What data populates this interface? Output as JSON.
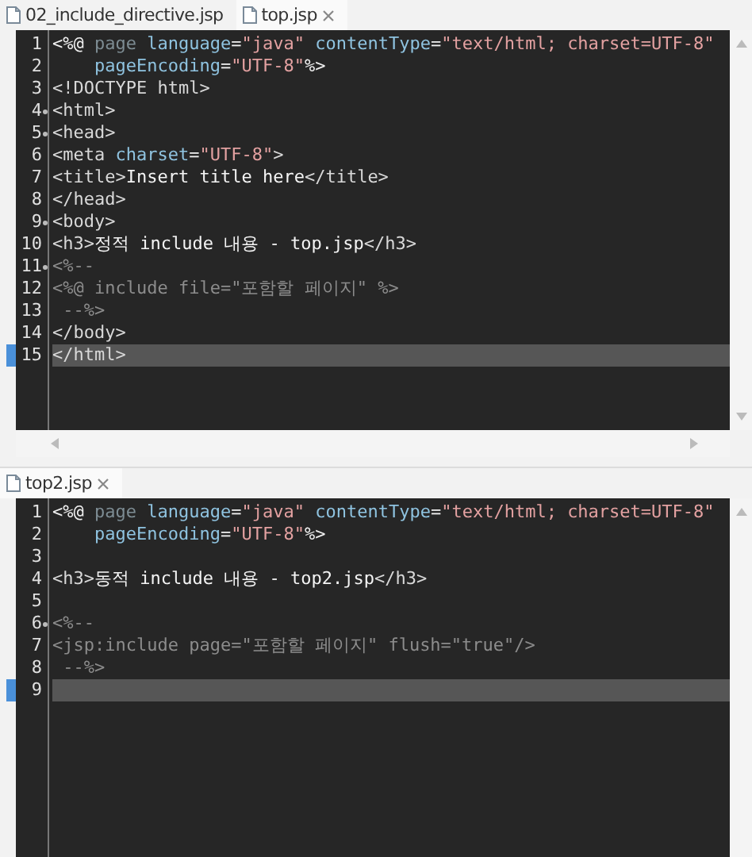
{
  "editors": [
    {
      "tabs": [
        {
          "label": "02_include_directive.jsp",
          "selected": false
        },
        {
          "label": "top.jsp",
          "selected": true
        }
      ],
      "horizontal_scrollbar": true,
      "lines": [
        {
          "number": "1",
          "fold": false,
          "current": false,
          "tokens": [
            {
              "kind": "punct",
              "text": "<%@"
            },
            {
              "kind": "directive",
              "text": " page"
            },
            {
              "kind": "attr",
              "text": " language"
            },
            {
              "kind": "punct",
              "text": "="
            },
            {
              "kind": "string",
              "text": "\"java\""
            },
            {
              "kind": "attr",
              "text": " contentType"
            },
            {
              "kind": "punct",
              "text": "="
            },
            {
              "kind": "string",
              "text": "\"text/html; charset=UTF-8\""
            }
          ]
        },
        {
          "number": "2",
          "fold": false,
          "current": false,
          "tokens": [
            {
              "kind": "attr",
              "text": "    pageEncoding"
            },
            {
              "kind": "punct",
              "text": "="
            },
            {
              "kind": "string",
              "text": "\"UTF-8\""
            },
            {
              "kind": "punct",
              "text": "%>"
            }
          ]
        },
        {
          "number": "3",
          "fold": false,
          "current": false,
          "tokens": [
            {
              "kind": "tag",
              "text": "<!DOCTYPE html>"
            }
          ]
        },
        {
          "number": "4",
          "fold": true,
          "current": false,
          "tokens": [
            {
              "kind": "tag",
              "text": "<html>"
            }
          ]
        },
        {
          "number": "5",
          "fold": true,
          "current": false,
          "tokens": [
            {
              "kind": "tag",
              "text": "<head>"
            }
          ]
        },
        {
          "number": "6",
          "fold": false,
          "current": false,
          "tokens": [
            {
              "kind": "tag",
              "text": "<meta"
            },
            {
              "kind": "attr",
              "text": " charset"
            },
            {
              "kind": "punct",
              "text": "="
            },
            {
              "kind": "string",
              "text": "\"UTF-8\""
            },
            {
              "kind": "tag",
              "text": ">"
            }
          ]
        },
        {
          "number": "7",
          "fold": false,
          "current": false,
          "tokens": [
            {
              "kind": "tag",
              "text": "<title>"
            },
            {
              "kind": "text",
              "text": "Insert title here"
            },
            {
              "kind": "tag",
              "text": "</title>"
            }
          ]
        },
        {
          "number": "8",
          "fold": false,
          "current": false,
          "tokens": [
            {
              "kind": "tag",
              "text": "</head>"
            }
          ]
        },
        {
          "number": "9",
          "fold": true,
          "current": false,
          "tokens": [
            {
              "kind": "tag",
              "text": "<body>"
            }
          ]
        },
        {
          "number": "10",
          "fold": false,
          "current": false,
          "tokens": [
            {
              "kind": "tag",
              "text": "<h3>"
            },
            {
              "kind": "text",
              "text": "정적 include 내용 - top.jsp"
            },
            {
              "kind": "tag",
              "text": "</h3>"
            }
          ]
        },
        {
          "number": "11",
          "fold": true,
          "current": false,
          "tokens": [
            {
              "kind": "comment",
              "text": "<%--"
            }
          ]
        },
        {
          "number": "12",
          "fold": false,
          "current": false,
          "tokens": [
            {
              "kind": "comment",
              "text": "<%@ include file=\"포함할 페이지\" %>"
            }
          ]
        },
        {
          "number": "13",
          "fold": false,
          "current": false,
          "tokens": [
            {
              "kind": "comment",
              "text": " --%>"
            }
          ]
        },
        {
          "number": "14",
          "fold": false,
          "current": false,
          "tokens": [
            {
              "kind": "tag",
              "text": "</body>"
            }
          ]
        },
        {
          "number": "15",
          "fold": false,
          "current": true,
          "tokens": [
            {
              "kind": "tag",
              "text": "</html>"
            }
          ]
        }
      ]
    },
    {
      "tabs": [
        {
          "label": "top2.jsp",
          "selected": true
        }
      ],
      "horizontal_scrollbar": false,
      "lines": [
        {
          "number": "1",
          "fold": false,
          "current": false,
          "tokens": [
            {
              "kind": "punct",
              "text": "<%@"
            },
            {
              "kind": "directive",
              "text": " page"
            },
            {
              "kind": "attr",
              "text": " language"
            },
            {
              "kind": "punct",
              "text": "="
            },
            {
              "kind": "string",
              "text": "\"java\""
            },
            {
              "kind": "attr",
              "text": " contentType"
            },
            {
              "kind": "punct",
              "text": "="
            },
            {
              "kind": "string",
              "text": "\"text/html; charset=UTF-8\""
            }
          ]
        },
        {
          "number": "2",
          "fold": false,
          "current": false,
          "tokens": [
            {
              "kind": "attr",
              "text": "    pageEncoding"
            },
            {
              "kind": "punct",
              "text": "="
            },
            {
              "kind": "string",
              "text": "\"UTF-8\""
            },
            {
              "kind": "punct",
              "text": "%>"
            }
          ]
        },
        {
          "number": "3",
          "fold": false,
          "current": false
        },
        {
          "number": "4",
          "fold": false,
          "current": false,
          "tokens": [
            {
              "kind": "tag",
              "text": "<h3>"
            },
            {
              "kind": "text",
              "text": "동적 include 내용 - top2.jsp"
            },
            {
              "kind": "tag",
              "text": "</h3>"
            }
          ]
        },
        {
          "number": "5",
          "fold": false,
          "current": false
        },
        {
          "number": "6",
          "fold": true,
          "current": false,
          "tokens": [
            {
              "kind": "comment",
              "text": "<%--"
            }
          ]
        },
        {
          "number": "7",
          "fold": false,
          "current": false,
          "tokens": [
            {
              "kind": "comment",
              "text": "<jsp:include page=\"포함할 페이지\" flush=\"true\"/>"
            }
          ]
        },
        {
          "number": "8",
          "fold": false,
          "current": false,
          "tokens": [
            {
              "kind": "comment",
              "text": " --%>"
            }
          ]
        },
        {
          "number": "9",
          "fold": false,
          "current": true
        }
      ]
    }
  ]
}
